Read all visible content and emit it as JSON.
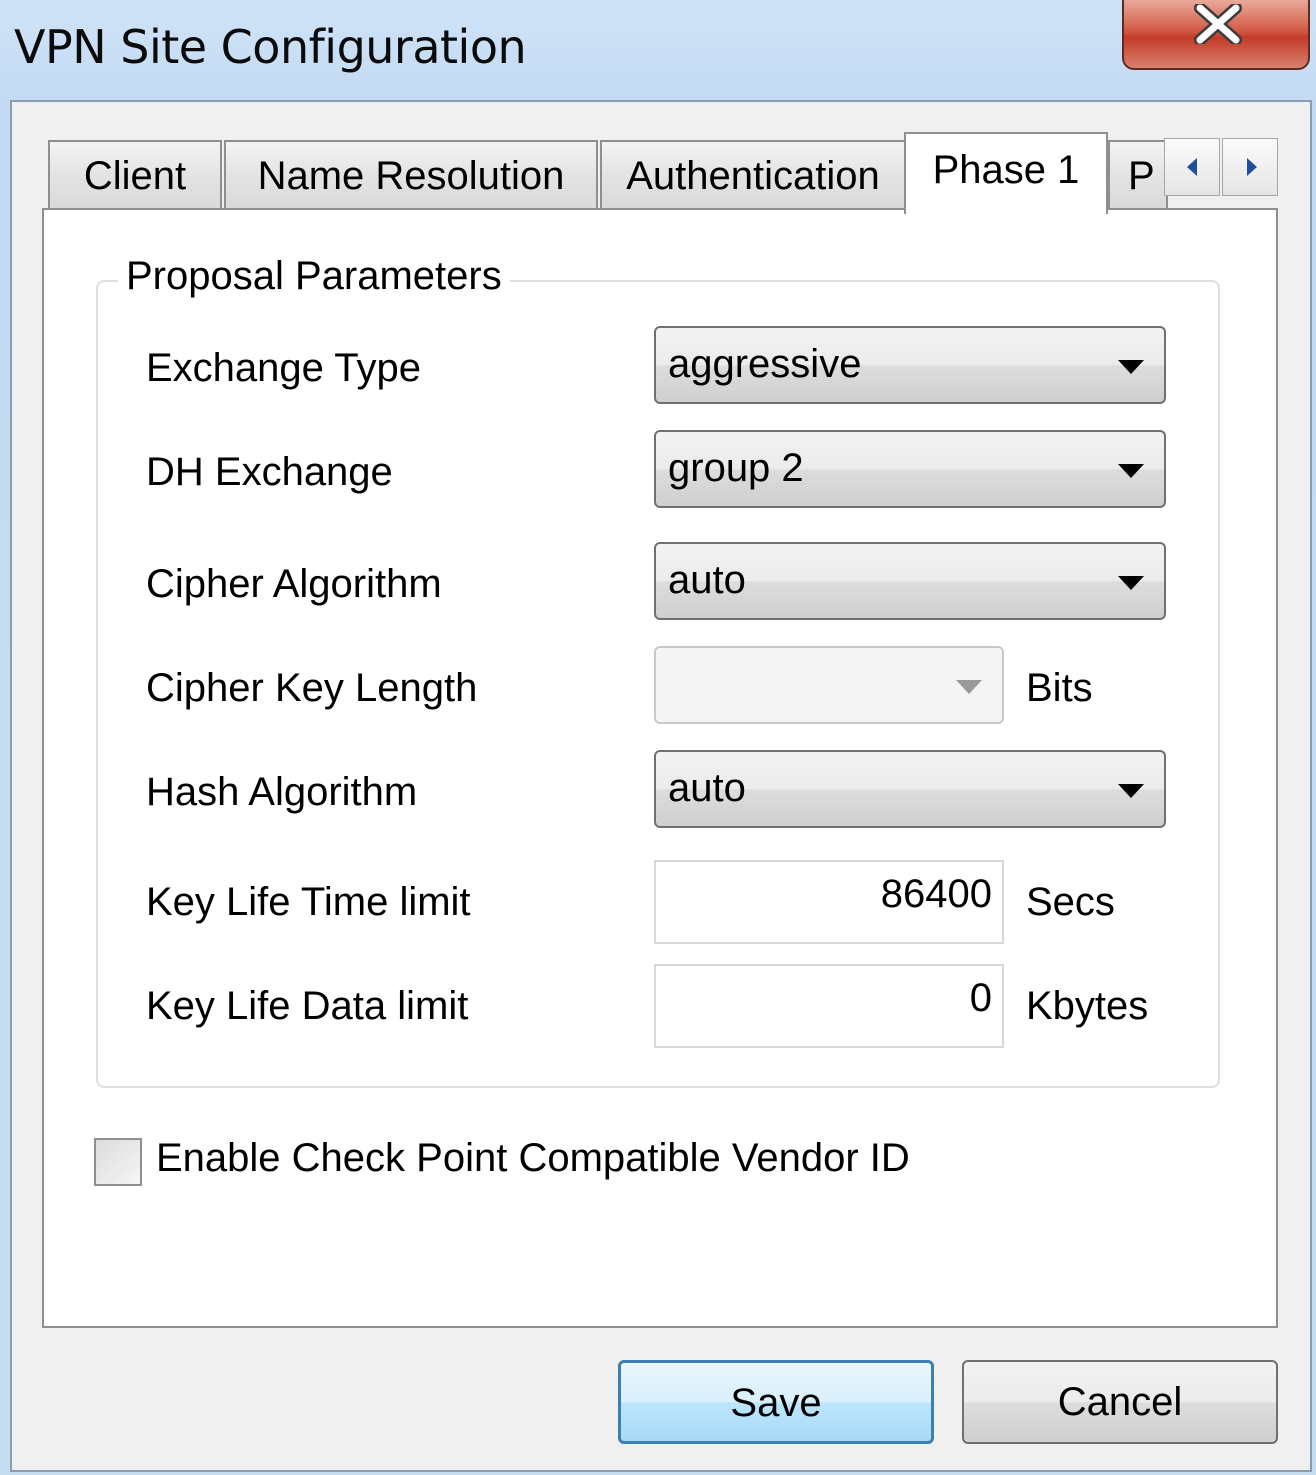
{
  "window": {
    "title": "VPN Site Configuration",
    "close_icon": "close-icon"
  },
  "tabs": [
    {
      "label": "Client",
      "active": false
    },
    {
      "label": "Name Resolution",
      "active": false
    },
    {
      "label": "Authentication",
      "active": false
    },
    {
      "label": "Phase 1",
      "active": true
    },
    {
      "label": "P",
      "active": false
    }
  ],
  "tab_scroll": {
    "left_icon": "arrow-left-icon",
    "right_icon": "arrow-right-icon"
  },
  "proposal": {
    "title": "Proposal Parameters",
    "exchange_type": {
      "label": "Exchange Type",
      "value": "aggressive"
    },
    "dh_exchange": {
      "label": "DH Exchange",
      "value": "group 2"
    },
    "cipher_algorithm": {
      "label": "Cipher Algorithm",
      "value": "auto"
    },
    "cipher_key_length": {
      "label": "Cipher Key Length",
      "value": "",
      "unit": "Bits"
    },
    "hash_algorithm": {
      "label": "Hash Algorithm",
      "value": "auto"
    },
    "key_life_time": {
      "label": "Key Life Time limit",
      "value": "86400",
      "unit": "Secs"
    },
    "key_life_data": {
      "label": "Key Life Data limit",
      "value": "0",
      "unit": "Kbytes"
    }
  },
  "checkpoint": {
    "label": "Enable Check Point Compatible Vendor ID",
    "checked": false
  },
  "buttons": {
    "save": "Save",
    "cancel": "Cancel"
  }
}
